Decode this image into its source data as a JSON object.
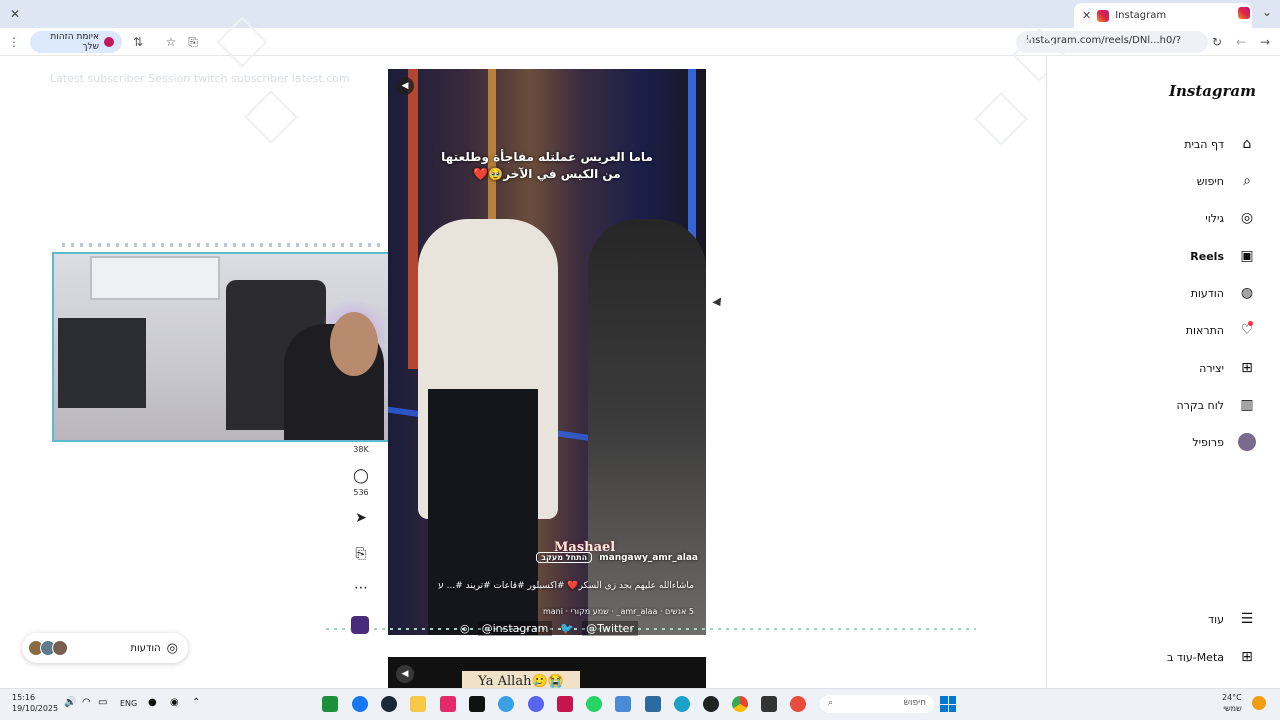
{
  "browser": {
    "tab_title": "Instagram",
    "address": "instagram.com/reels/DNl...h0/?",
    "hidden_pill": "איומת הזהות שלך",
    "overlay_text": "Latest subscriber  Session twitch subscriber  latest.com"
  },
  "reel": {
    "caption_line1": "ماما العريس عملتله مفاجأة وطلعتها",
    "caption_line2": "من الكيس في الآخر🥹❤️",
    "author": "mangawy_amr_alaa",
    "follow": "התחל מעקב",
    "watermark": "Mashael",
    "description": "ماشاءالله عليهم بجد زي السكر❤️ #اكسبلور #قاعات #تريند #... עוד",
    "meta": "5 אנשים · amr_alaa_ · שמע מקורי · mani",
    "likes": "38K",
    "comments": "536"
  },
  "reel2": {
    "label": "Ya Allah🥲😭"
  },
  "socials": {
    "instagram": "@instagram",
    "twitter": "@Twitter"
  },
  "messages_pill": {
    "label": "הודעות"
  },
  "sidebar": {
    "logo": "Instagram",
    "items": [
      {
        "label": "דף הבית",
        "icon": "home-icon"
      },
      {
        "label": "חיפוש",
        "icon": "search-icon"
      },
      {
        "label": "גילוי",
        "icon": "compass-icon"
      },
      {
        "label": "Reels",
        "icon": "reels-icon"
      },
      {
        "label": "הודעות",
        "icon": "messenger-icon"
      },
      {
        "label": "התראות",
        "icon": "heart-icon"
      },
      {
        "label": "יצירה",
        "icon": "plus-icon"
      },
      {
        "label": "לוח בקרה",
        "icon": "dashboard-icon"
      },
      {
        "label": "פרופיל",
        "icon": "profile-avatar"
      },
      {
        "label": "עוד",
        "icon": "menu-icon"
      },
      {
        "label": "עוד ב-Meta",
        "icon": "meta-grid-icon"
      }
    ]
  },
  "taskbar": {
    "time": "15:16",
    "date": "19/10/2025",
    "lang": "ENG",
    "search_placeholder": "חיפוש",
    "weather_temp": "24°C",
    "weather_label": "שמשי"
  }
}
